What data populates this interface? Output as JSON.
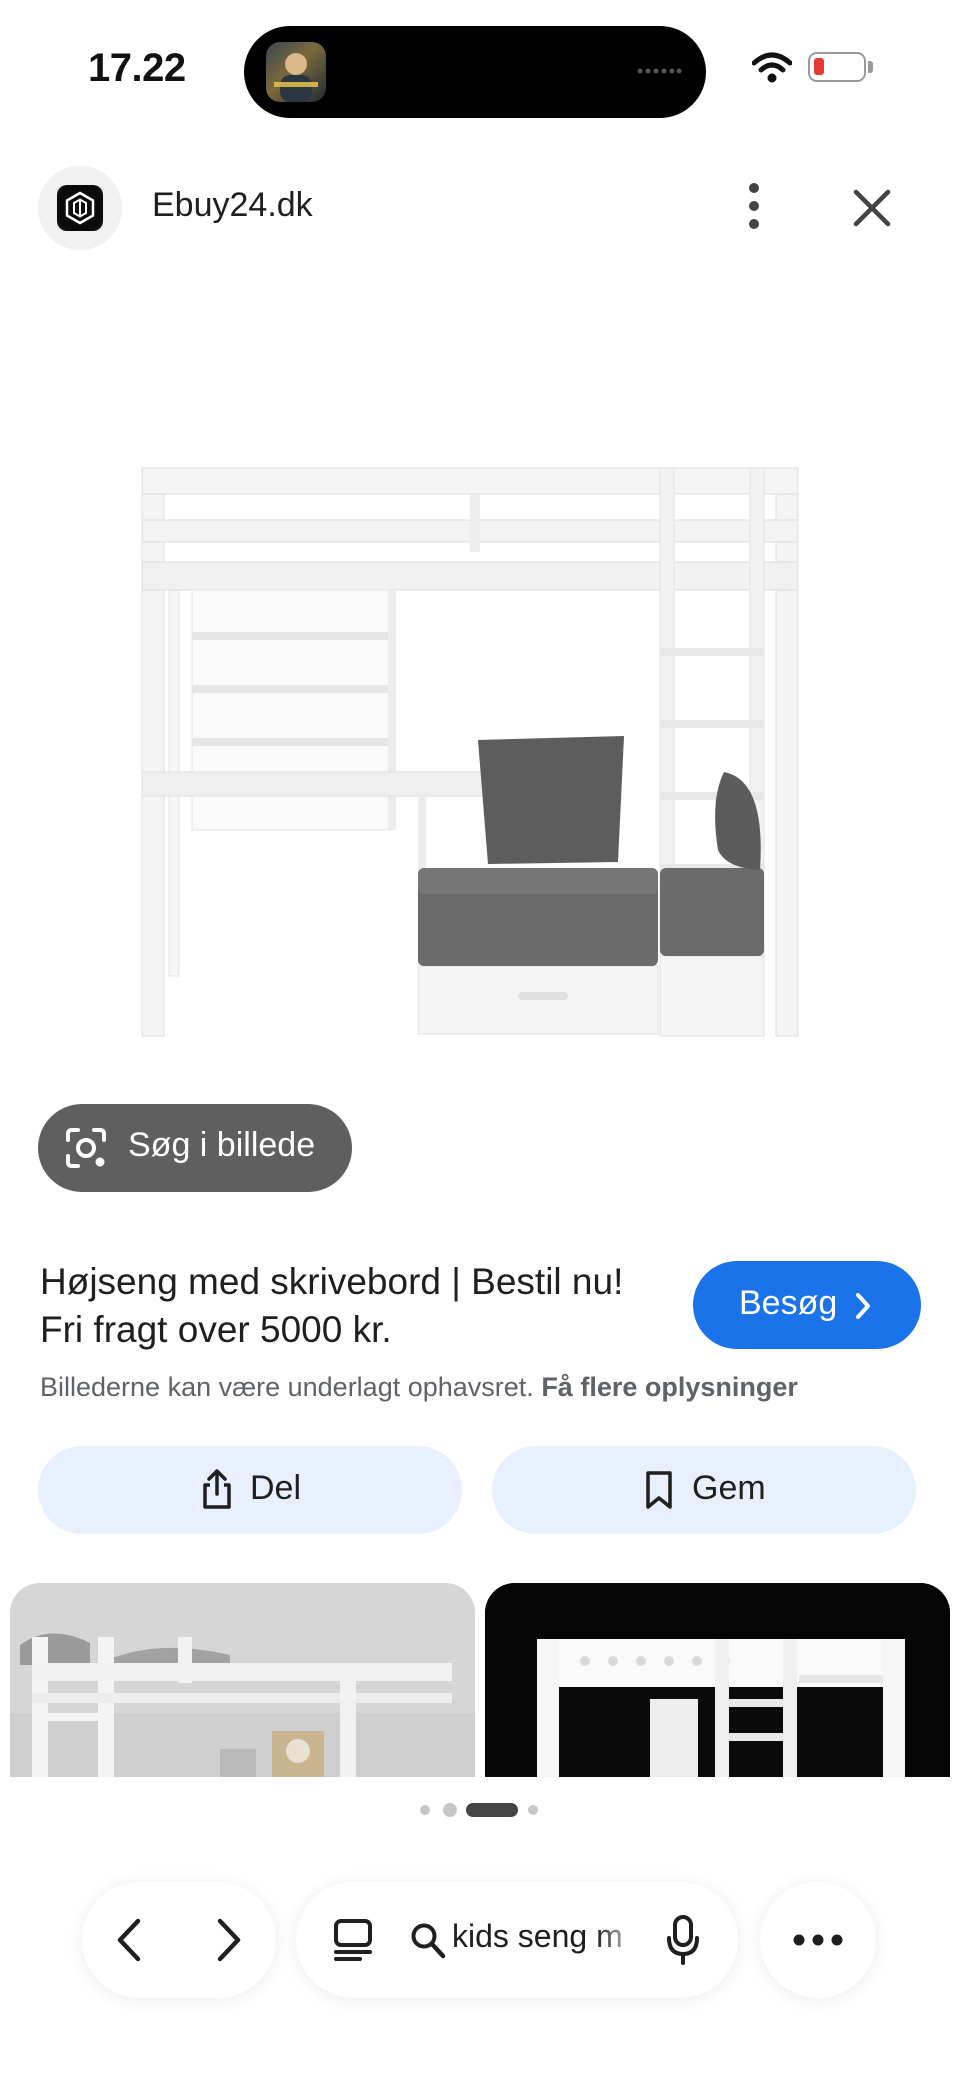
{
  "status_bar": {
    "time": "17.22",
    "battery_color": "#e53935"
  },
  "site": {
    "name": "Ebuy24.dk",
    "icons": [
      "site-logo-icon",
      "more-vert-icon",
      "close-icon"
    ]
  },
  "lens": {
    "label": "Søg i billede",
    "icon": "lens-icon"
  },
  "result": {
    "title": "Højseng med skrivebord | Bestil nu! Fri fragt over 5000 kr.",
    "visit_label": "Besøg",
    "visit_color": "#1a73e8",
    "copyright_text": "Billederne kan være underlagt ophavsret.",
    "copyright_link": "Få flere oplysninger"
  },
  "actions": {
    "share_label": "Del",
    "save_label": "Gem"
  },
  "pager": {
    "count": 4,
    "active_index": 2
  },
  "toolbar": {
    "search_query": "kids seng m",
    "icons": [
      "back-icon",
      "forward-icon",
      "tabs-icon",
      "search-icon",
      "mic-icon",
      "more-horiz-icon"
    ]
  }
}
